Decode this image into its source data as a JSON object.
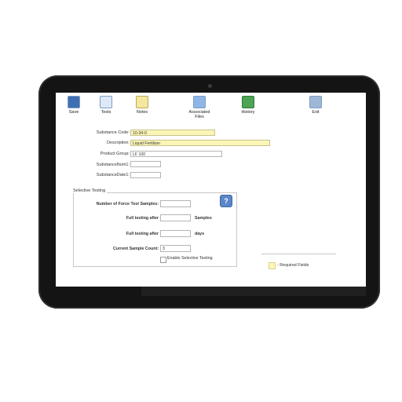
{
  "toolbar": {
    "buttons": [
      {
        "label": "Save",
        "icon": "save-icon"
      },
      {
        "label": "Tests",
        "icon": "tests-icon"
      },
      {
        "label": "Notes",
        "icon": "notes-icon"
      },
      {
        "label": "Associated Files",
        "icon": "associated-files-icon"
      },
      {
        "label": "History",
        "icon": "history-icon"
      },
      {
        "label": "Exit",
        "icon": "exit-icon"
      }
    ]
  },
  "form": {
    "substance_code": {
      "label": "Substance Code:",
      "value": "10-34-0"
    },
    "description": {
      "label": "Description:",
      "value": "Liquid Fertilizer"
    },
    "product_group": {
      "label": "Product Group:",
      "value": "LF 100"
    },
    "substance_num1": {
      "label": "SubstanceNum1:",
      "value": ""
    },
    "substance_date1": {
      "label": "SubstanceDate1:",
      "value": ""
    }
  },
  "selective_testing": {
    "title": "Selective Testing",
    "num_force_test_samples": {
      "label": "Number of Force Test Samples:",
      "value": ""
    },
    "full_testing_after_samples": {
      "label": "Full testing after",
      "value": "",
      "unit": "Samples"
    },
    "full_testing_after_days": {
      "label": "Full testing after",
      "value": "",
      "unit": "days"
    },
    "current_sample_count": {
      "label": "Current Sample Count:",
      "value": "3"
    },
    "enable_checkbox_label": "Enable Selective Testing",
    "enable_checked": false
  },
  "legend": {
    "text": "- Required Fields",
    "required_color": "#fbf5b6"
  },
  "colors": {
    "bezel": "#141414",
    "accent": "#3f6fb3"
  }
}
